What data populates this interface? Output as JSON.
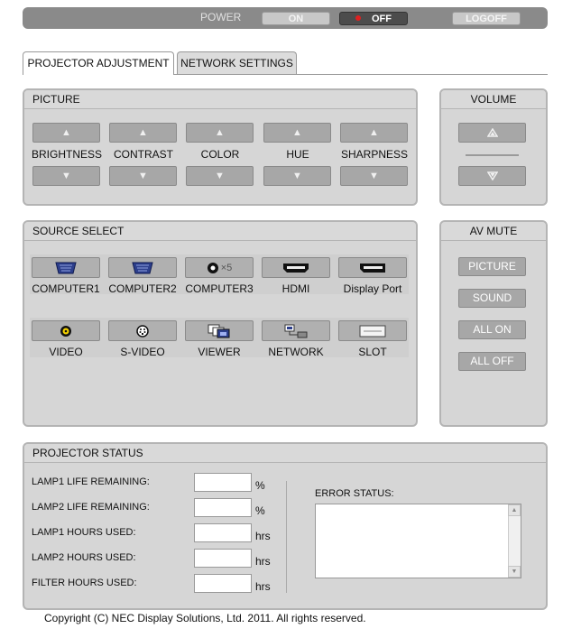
{
  "power": {
    "label": "POWER",
    "on_label": "ON",
    "off_label": "OFF",
    "logoff_label": "LOGOFF"
  },
  "tabs": [
    {
      "label": "PROJECTOR ADJUSTMENT",
      "active": true
    },
    {
      "label": "NETWORK SETTINGS",
      "active": false
    }
  ],
  "picture": {
    "title": "PICTURE",
    "controls": [
      "BRIGHTNESS",
      "CONTRAST",
      "COLOR",
      "HUE",
      "SHARPNESS"
    ]
  },
  "volume": {
    "title": "VOLUME"
  },
  "source_select": {
    "title": "SOURCE SELECT",
    "row1": [
      "COMPUTER1",
      "COMPUTER2",
      "COMPUTER3",
      "HDMI",
      "Display Port"
    ],
    "row2": [
      "VIDEO",
      "S-VIDEO",
      "VIEWER",
      "NETWORK",
      "SLOT"
    ],
    "computer3_badge": "×5"
  },
  "av_mute": {
    "title": "AV MUTE",
    "buttons": [
      "PICTURE",
      "SOUND",
      "ALL ON",
      "ALL OFF"
    ]
  },
  "projector_status": {
    "title": "PROJECTOR STATUS",
    "rows": [
      {
        "label": "LAMP1 LIFE REMAINING:",
        "value": "",
        "unit": "%"
      },
      {
        "label": "LAMP2 LIFE REMAINING:",
        "value": "",
        "unit": "%"
      },
      {
        "label": "LAMP1 HOURS USED:",
        "value": "",
        "unit": "hrs"
      },
      {
        "label": "LAMP2 HOURS USED:",
        "value": "",
        "unit": "hrs"
      },
      {
        "label": "FILTER HOURS USED:",
        "value": "",
        "unit": "hrs"
      }
    ],
    "error_label": "ERROR STATUS:",
    "error_value": ""
  },
  "footer": {
    "copyright": "Copyright (C) NEC Display Solutions, Ltd. 2011. All rights reserved."
  },
  "colors": {
    "panel": "#d6d6d6",
    "button": "#a7a7a7",
    "off_button": "#4c4c4c",
    "power_dot": "#e02020"
  }
}
